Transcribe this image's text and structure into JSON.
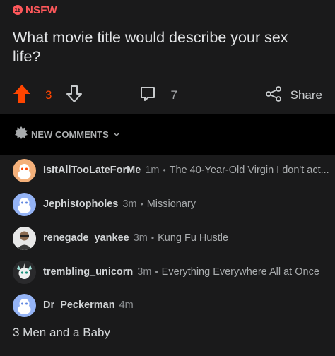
{
  "post": {
    "badge_number": "18",
    "nsfw_label": "NSFW",
    "title": "What movie title would describe your sex life?",
    "vote_count": "3",
    "comment_count": "7",
    "share_label": "Share"
  },
  "sort": {
    "label": "NEW COMMENTS"
  },
  "comments": [
    {
      "username": "IsItAllTooLateForMe",
      "age": "1m",
      "preview": "The 40-Year-Old Virgin I don't act..."
    },
    {
      "username": "Jephistopholes",
      "age": "3m",
      "preview": "Missionary"
    },
    {
      "username": "renegade_yankee",
      "age": "3m",
      "preview": "Kung Fu Hustle"
    },
    {
      "username": "trembling_unicorn",
      "age": "3m",
      "preview": "Everything Everywhere All at Once"
    }
  ],
  "expanded_comment": {
    "username": "Dr_Peckerman",
    "age": "4m",
    "body": "3 Men and a Baby"
  },
  "colors": {
    "accent": "#ff4500",
    "nsfw": "#ff585b",
    "background": "#1a1a1b",
    "separator": "#000000"
  }
}
